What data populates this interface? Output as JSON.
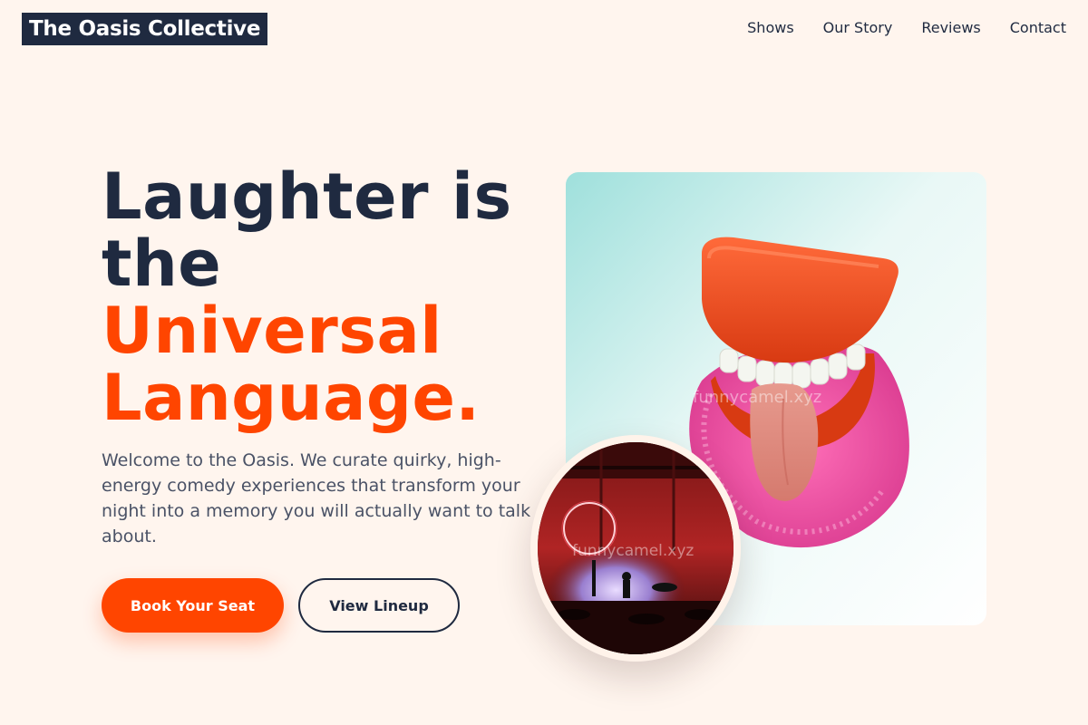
{
  "brand": {
    "name": "The Oasis Collective"
  },
  "nav": {
    "items": [
      {
        "label": "Shows"
      },
      {
        "label": "Our Story"
      },
      {
        "label": "Reviews"
      },
      {
        "label": "Contact"
      }
    ]
  },
  "hero": {
    "title_line1": "Laughter is",
    "title_line2": "the",
    "title_accent1": "Universal",
    "title_accent2": "Language.",
    "description": "Welcome to the Oasis. We curate quirky, high-energy comedy experiences that transform your night into a memory you will actually want to talk about.",
    "primary_cta": "Book Your Seat",
    "secondary_cta": "View Lineup"
  },
  "images": {
    "main_icon": "wind-up-chattering-teeth-photo",
    "circle_icon": "comedy-club-stage-photo",
    "watermark": "funnycamel.xyz"
  },
  "colors": {
    "accent": "#ff4500",
    "dark": "#1f2a40",
    "background": "#fff5ee",
    "body_text": "#4a5266"
  }
}
